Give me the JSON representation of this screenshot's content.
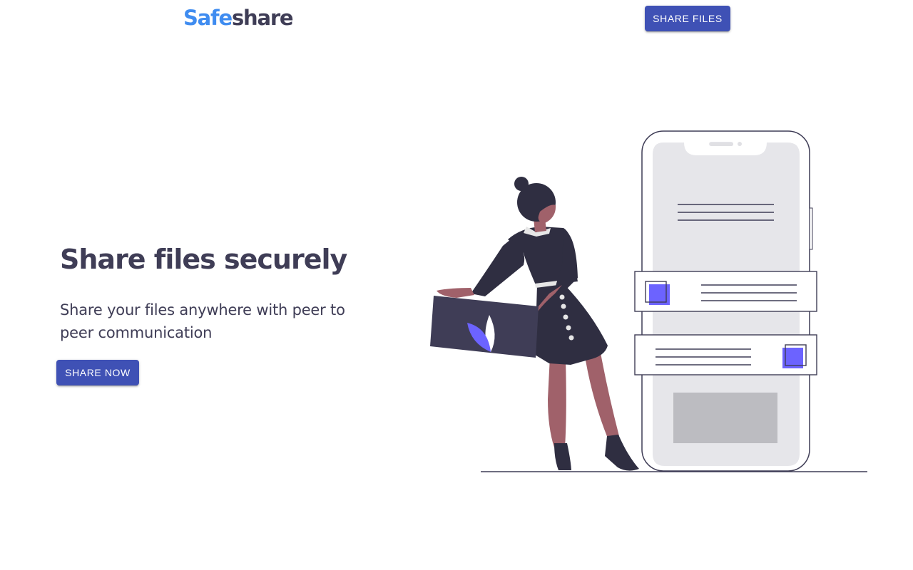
{
  "header": {
    "logo_part1": "Safe",
    "logo_part2": "share",
    "share_files_label": "SHARE FILES"
  },
  "hero": {
    "title": "Share files securely",
    "subtitle": "Share your files anywhere with peer to peer communication",
    "share_now_label": "SHARE NOW"
  },
  "colors": {
    "primary": "#3f51b5",
    "logo_blue": "#3f8cf0",
    "text_dark": "#3f3d56",
    "accent_purple": "#6c63ff"
  }
}
